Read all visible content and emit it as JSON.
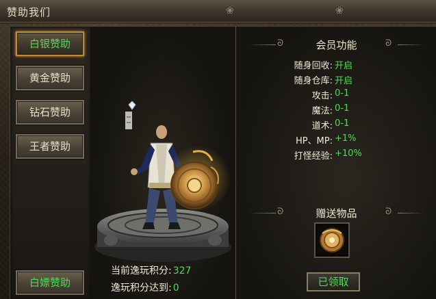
{
  "window": {
    "title": "赞助我们"
  },
  "tabs": [
    {
      "label": "白银赞助",
      "active": true
    },
    {
      "label": "黄金赞助",
      "active": false
    },
    {
      "label": "钻石赞助",
      "active": false
    },
    {
      "label": "王者赞助",
      "active": false
    }
  ],
  "bottom_tab": {
    "label": "白嫖赞助"
  },
  "member_section": {
    "title": "会员功能"
  },
  "features": [
    {
      "label": "随身回收:",
      "value": "开启"
    },
    {
      "label": "随身仓库:",
      "value": "开启"
    },
    {
      "label": "攻击:",
      "value": "0-1"
    },
    {
      "label": "魔法:",
      "value": "0-1"
    },
    {
      "label": "道术:",
      "value": "0-1"
    },
    {
      "label": "HP、MP:",
      "value": "+1%"
    },
    {
      "label": "打怪经验:",
      "value": "+10%"
    }
  ],
  "gift_section": {
    "title": "赠送物品",
    "item_icon": "golden-shield-icon"
  },
  "claim_button": {
    "label": "已领取"
  },
  "score": {
    "current_label": "当前逸玩积分:",
    "current_value": "327",
    "target_label": "逸玩积分达到:",
    "target_value": "0"
  },
  "colors": {
    "accent_green": "#52d85a",
    "active_border": "#c08a3a",
    "text": "#f2ead7"
  }
}
